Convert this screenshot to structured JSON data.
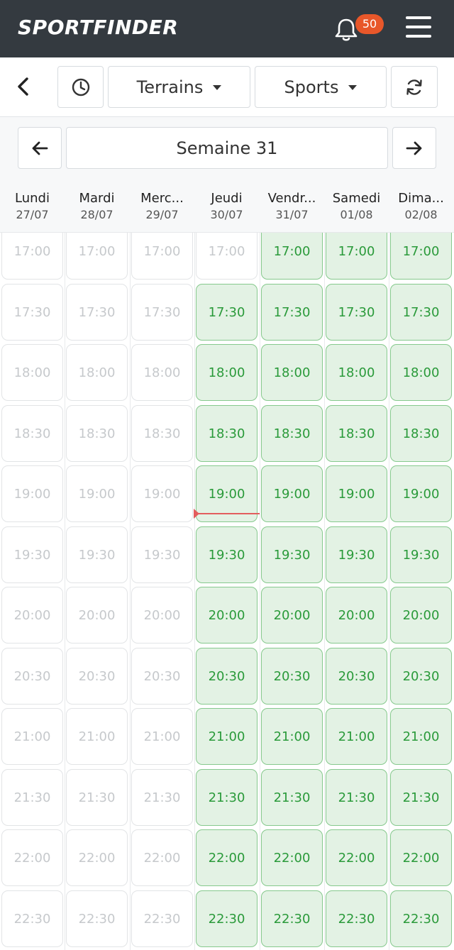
{
  "brand": {
    "bold": "SPORT",
    "light": "FINDER"
  },
  "notifications": {
    "count": "50"
  },
  "filters": {
    "terrains_label": "Terrains",
    "sports_label": "Sports"
  },
  "week": {
    "label": "Semaine 31"
  },
  "days": [
    {
      "name": "Lundi",
      "date": "27/07"
    },
    {
      "name": "Mardi",
      "date": "28/07"
    },
    {
      "name": "Merc...",
      "date": "29/07"
    },
    {
      "name": "Jeudi",
      "date": "30/07"
    },
    {
      "name": "Vendr...",
      "date": "31/07"
    },
    {
      "name": "Samedi",
      "date": "01/08"
    },
    {
      "name": "Dima...",
      "date": "02/08"
    }
  ],
  "times": [
    "17:00",
    "17:30",
    "18:00",
    "18:30",
    "19:00",
    "19:30",
    "20:00",
    "20:30",
    "21:00",
    "21:30",
    "22:00",
    "22:30"
  ],
  "availability": [
    [
      false,
      false,
      false,
      false,
      false,
      false,
      false,
      false,
      false,
      false,
      false,
      false
    ],
    [
      false,
      false,
      false,
      false,
      false,
      false,
      false,
      false,
      false,
      false,
      false,
      false
    ],
    [
      false,
      false,
      false,
      false,
      false,
      false,
      false,
      false,
      false,
      false,
      false,
      false
    ],
    [
      false,
      true,
      true,
      true,
      true,
      true,
      true,
      true,
      true,
      true,
      true,
      true
    ],
    [
      true,
      true,
      true,
      true,
      true,
      true,
      true,
      true,
      true,
      true,
      true,
      true
    ],
    [
      true,
      true,
      true,
      true,
      true,
      true,
      true,
      true,
      true,
      true,
      true,
      true
    ],
    [
      true,
      true,
      true,
      true,
      true,
      true,
      true,
      true,
      true,
      true,
      true,
      true
    ]
  ],
  "colors": {
    "navbar": "#343a40",
    "badge": "#e8572a",
    "available_bg": "#e3f2e4",
    "available_text": "#2a9a3a",
    "now_line": "#e35d5d"
  }
}
